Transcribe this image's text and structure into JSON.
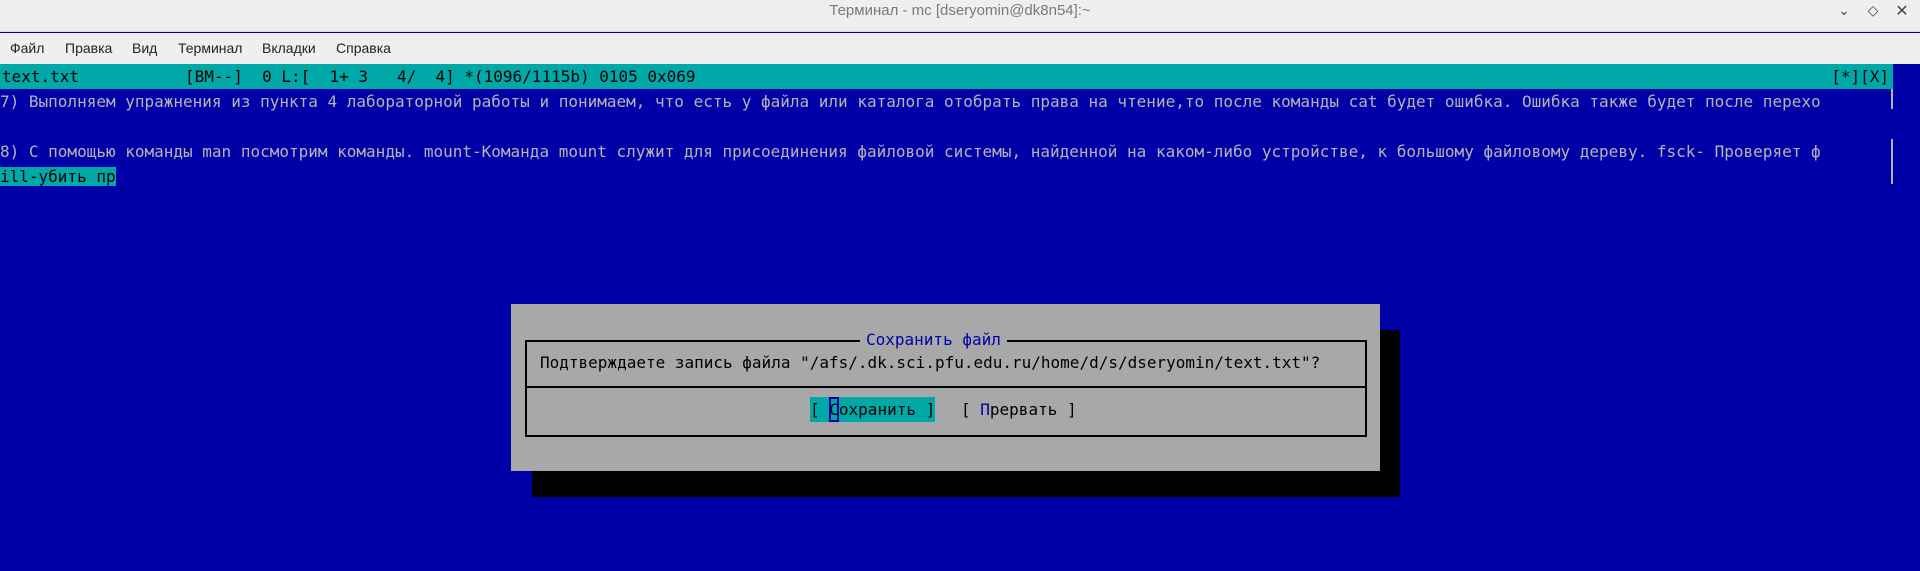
{
  "window": {
    "title": "Терминал - mc [dseryomin@dk8n54]:~",
    "controls": [
      "minimize",
      "restore",
      "close"
    ]
  },
  "menu": {
    "items": [
      "Файл",
      "Правка",
      "Вид",
      "Терминал",
      "Вкладки",
      "Справка"
    ]
  },
  "editor": {
    "status_left": "text.txt           [BM--]  0 L:[  1+ 3   4/  4] *(1096/1115b) 0105 0x069",
    "status_right": "[*][X]",
    "lines": [
      "7) Выполняем упражнения из пункта 4 лабораторной работы и понимаем, что есть у файла или каталога отобрать права на чтение,то после команды cat будет ошибка. Ошибка также будет после перехо",
      "",
      "8) С помощью команды man посмотрим команды. mount-Команда mount служит для присоединения файловой системы, найденной на каком-либо устройстве, к большому файловому дереву. fsck- Проверяет ф"
    ],
    "highlight_line": "ill-убить пр"
  },
  "dialog": {
    "title": "Сохранить файл",
    "message": "Подтверждаете запись файла \"/afs/.dk.sci.pfu.edu.ru/home/d/s/dseryomin/text.txt\"?",
    "save_button": {
      "open": "[ ",
      "hotkey": "С",
      "rest": "охранить ]"
    },
    "abort_button": {
      "open": "[ ",
      "hotkey": "П",
      "rest": "рервать ]"
    }
  }
}
